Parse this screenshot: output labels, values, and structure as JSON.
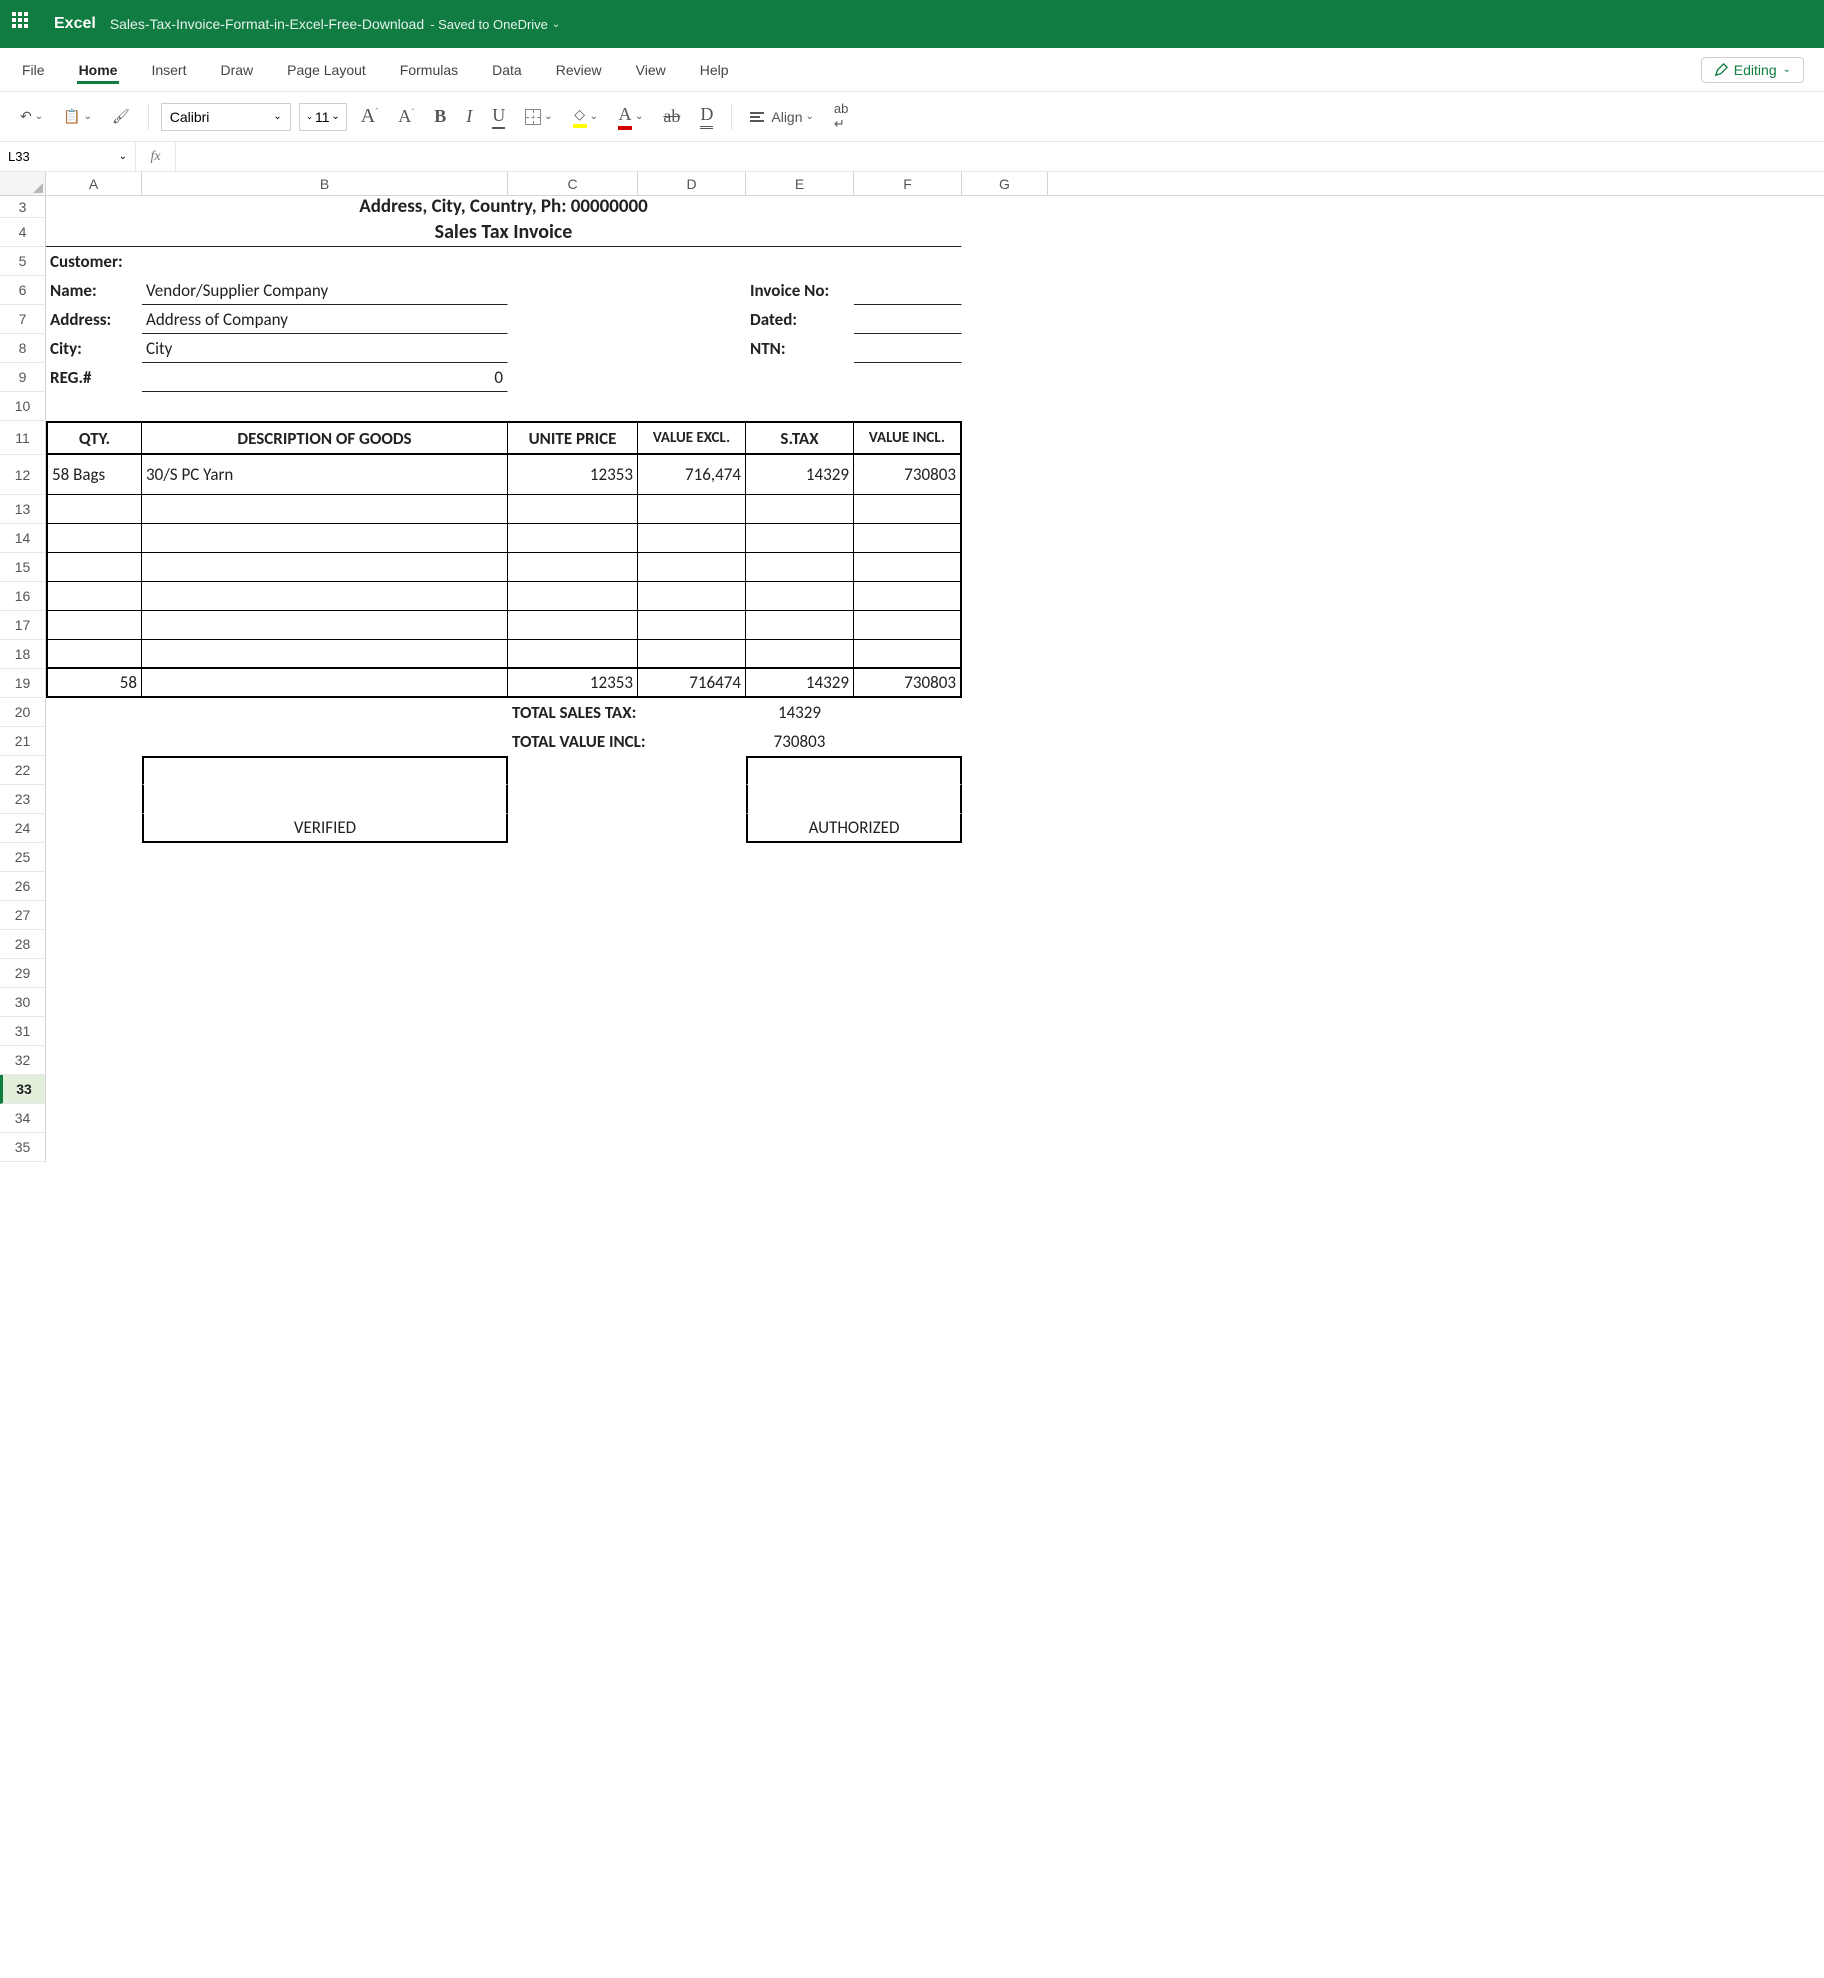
{
  "titlebar": {
    "app": "Excel",
    "doc": "Sales-Tax-Invoice-Format-in-Excel-Free-Download",
    "status": "- Saved to OneDrive"
  },
  "menu": {
    "items": [
      "File",
      "Home",
      "Insert",
      "Draw",
      "Page Layout",
      "Formulas",
      "Data",
      "Review",
      "View",
      "Help"
    ],
    "active": "Home",
    "editing": "Editing"
  },
  "ribbon": {
    "fontName": "Calibri",
    "fontSize": "11",
    "align": "Align"
  },
  "formulaBar": {
    "name": "L33",
    "formula": ""
  },
  "colHeaders": [
    "A",
    "B",
    "C",
    "D",
    "E",
    "F",
    "G"
  ],
  "rowNumbers": [
    3,
    4,
    5,
    6,
    7,
    8,
    9,
    10,
    11,
    12,
    13,
    14,
    15,
    16,
    17,
    18,
    19,
    20,
    21,
    22,
    23,
    24,
    25,
    26,
    27,
    28,
    29,
    30,
    31,
    32,
    33,
    34,
    35
  ],
  "selectedRow": 33,
  "sheet": {
    "addressLine": "Address, City, Country, Ph: 00000000",
    "docTitle": "Sales Tax Invoice",
    "customerLbl": "Customer:",
    "nameLbl": "Name:",
    "nameVal": "Vendor/Supplier Company",
    "addressLbl": "Address:",
    "addressVal": "Address of Company",
    "cityLbl": "City:",
    "cityVal": "City",
    "regLbl": "REG.#",
    "regVal": "0",
    "invoiceNoLbl": "Invoice No:",
    "datedLbl": "Dated:",
    "ntnLbl": "NTN:",
    "hdr": {
      "qty": "QTY.",
      "desc": "DESCRIPTION OF GOODS",
      "uprice": "UNITE PRICE",
      "vexcl": "VALUE EXCL.",
      "stax": "S.TAX",
      "vincl": "VALUE INCL."
    },
    "line": {
      "qty": "58 Bags",
      "desc": "30/S PC Yarn",
      "uprice": "12353",
      "vexcl": "716,474",
      "stax": "14329",
      "vincl": "730803"
    },
    "totals": {
      "qty": "58",
      "uprice": "12353",
      "vexcl": "716474",
      "stax": "14329",
      "vincl": "730803"
    },
    "totSalesTaxLbl": "TOTAL SALES TAX:",
    "totSalesTaxVal": "14329",
    "totValueInclLbl": "TOTAL VALUE INCL:",
    "totValueInclVal": "730803",
    "verified": "VERIFIED",
    "authorized": "AUTHORIZED"
  }
}
